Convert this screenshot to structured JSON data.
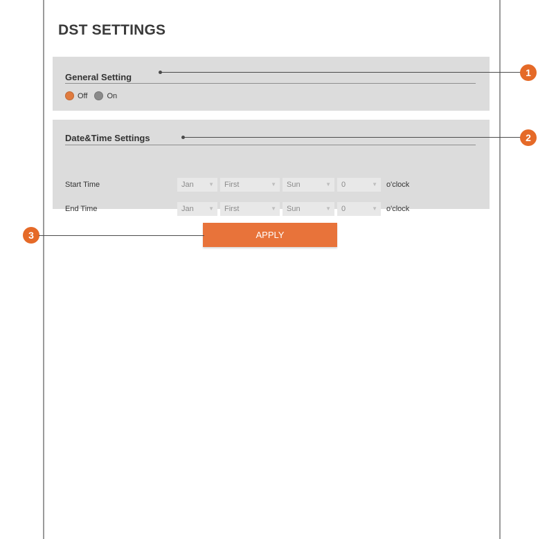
{
  "page": {
    "title": "DST SETTINGS"
  },
  "general": {
    "heading": "General Setting",
    "options": [
      {
        "label": "Off",
        "selected": true
      },
      {
        "label": "On",
        "selected": false
      }
    ]
  },
  "datetime": {
    "heading": "Date&Time Settings",
    "rows": [
      {
        "label": "Start Time",
        "month": "Jan",
        "week": "First",
        "day": "Sun",
        "hour": "0",
        "suffix": "o'clock"
      },
      {
        "label": "End Time",
        "month": "Jan",
        "week": "First",
        "day": "Sun",
        "hour": "0",
        "suffix": "o'clock"
      }
    ]
  },
  "apply_label": "APPLY",
  "callouts": {
    "one": "1",
    "two": "2",
    "three": "3"
  },
  "colors": {
    "accent": "#e8733a",
    "badge": "#e56a28",
    "panel": "#dcdcdc"
  },
  "icons": {
    "dropdown": "chevron-down-icon"
  }
}
